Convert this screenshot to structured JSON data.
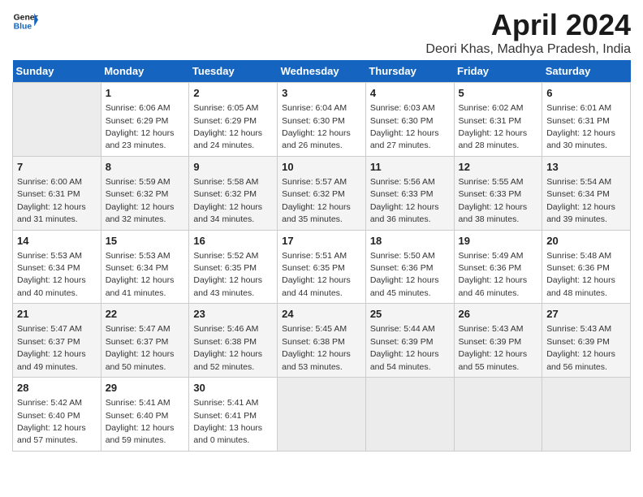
{
  "header": {
    "logo_line1": "General",
    "logo_line2": "Blue",
    "title": "April 2024",
    "subtitle": "Deori Khas, Madhya Pradesh, India"
  },
  "calendar": {
    "days_of_week": [
      "Sunday",
      "Monday",
      "Tuesday",
      "Wednesday",
      "Thursday",
      "Friday",
      "Saturday"
    ],
    "weeks": [
      [
        {
          "day": "",
          "detail": ""
        },
        {
          "day": "1",
          "detail": "Sunrise: 6:06 AM\nSunset: 6:29 PM\nDaylight: 12 hours\nand 23 minutes."
        },
        {
          "day": "2",
          "detail": "Sunrise: 6:05 AM\nSunset: 6:29 PM\nDaylight: 12 hours\nand 24 minutes."
        },
        {
          "day": "3",
          "detail": "Sunrise: 6:04 AM\nSunset: 6:30 PM\nDaylight: 12 hours\nand 26 minutes."
        },
        {
          "day": "4",
          "detail": "Sunrise: 6:03 AM\nSunset: 6:30 PM\nDaylight: 12 hours\nand 27 minutes."
        },
        {
          "day": "5",
          "detail": "Sunrise: 6:02 AM\nSunset: 6:31 PM\nDaylight: 12 hours\nand 28 minutes."
        },
        {
          "day": "6",
          "detail": "Sunrise: 6:01 AM\nSunset: 6:31 PM\nDaylight: 12 hours\nand 30 minutes."
        }
      ],
      [
        {
          "day": "7",
          "detail": "Sunrise: 6:00 AM\nSunset: 6:31 PM\nDaylight: 12 hours\nand 31 minutes."
        },
        {
          "day": "8",
          "detail": "Sunrise: 5:59 AM\nSunset: 6:32 PM\nDaylight: 12 hours\nand 32 minutes."
        },
        {
          "day": "9",
          "detail": "Sunrise: 5:58 AM\nSunset: 6:32 PM\nDaylight: 12 hours\nand 34 minutes."
        },
        {
          "day": "10",
          "detail": "Sunrise: 5:57 AM\nSunset: 6:32 PM\nDaylight: 12 hours\nand 35 minutes."
        },
        {
          "day": "11",
          "detail": "Sunrise: 5:56 AM\nSunset: 6:33 PM\nDaylight: 12 hours\nand 36 minutes."
        },
        {
          "day": "12",
          "detail": "Sunrise: 5:55 AM\nSunset: 6:33 PM\nDaylight: 12 hours\nand 38 minutes."
        },
        {
          "day": "13",
          "detail": "Sunrise: 5:54 AM\nSunset: 6:34 PM\nDaylight: 12 hours\nand 39 minutes."
        }
      ],
      [
        {
          "day": "14",
          "detail": "Sunrise: 5:53 AM\nSunset: 6:34 PM\nDaylight: 12 hours\nand 40 minutes."
        },
        {
          "day": "15",
          "detail": "Sunrise: 5:53 AM\nSunset: 6:34 PM\nDaylight: 12 hours\nand 41 minutes."
        },
        {
          "day": "16",
          "detail": "Sunrise: 5:52 AM\nSunset: 6:35 PM\nDaylight: 12 hours\nand 43 minutes."
        },
        {
          "day": "17",
          "detail": "Sunrise: 5:51 AM\nSunset: 6:35 PM\nDaylight: 12 hours\nand 44 minutes."
        },
        {
          "day": "18",
          "detail": "Sunrise: 5:50 AM\nSunset: 6:36 PM\nDaylight: 12 hours\nand 45 minutes."
        },
        {
          "day": "19",
          "detail": "Sunrise: 5:49 AM\nSunset: 6:36 PM\nDaylight: 12 hours\nand 46 minutes."
        },
        {
          "day": "20",
          "detail": "Sunrise: 5:48 AM\nSunset: 6:36 PM\nDaylight: 12 hours\nand 48 minutes."
        }
      ],
      [
        {
          "day": "21",
          "detail": "Sunrise: 5:47 AM\nSunset: 6:37 PM\nDaylight: 12 hours\nand 49 minutes."
        },
        {
          "day": "22",
          "detail": "Sunrise: 5:47 AM\nSunset: 6:37 PM\nDaylight: 12 hours\nand 50 minutes."
        },
        {
          "day": "23",
          "detail": "Sunrise: 5:46 AM\nSunset: 6:38 PM\nDaylight: 12 hours\nand 52 minutes."
        },
        {
          "day": "24",
          "detail": "Sunrise: 5:45 AM\nSunset: 6:38 PM\nDaylight: 12 hours\nand 53 minutes."
        },
        {
          "day": "25",
          "detail": "Sunrise: 5:44 AM\nSunset: 6:39 PM\nDaylight: 12 hours\nand 54 minutes."
        },
        {
          "day": "26",
          "detail": "Sunrise: 5:43 AM\nSunset: 6:39 PM\nDaylight: 12 hours\nand 55 minutes."
        },
        {
          "day": "27",
          "detail": "Sunrise: 5:43 AM\nSunset: 6:39 PM\nDaylight: 12 hours\nand 56 minutes."
        }
      ],
      [
        {
          "day": "28",
          "detail": "Sunrise: 5:42 AM\nSunset: 6:40 PM\nDaylight: 12 hours\nand 57 minutes."
        },
        {
          "day": "29",
          "detail": "Sunrise: 5:41 AM\nSunset: 6:40 PM\nDaylight: 12 hours\nand 59 minutes."
        },
        {
          "day": "30",
          "detail": "Sunrise: 5:41 AM\nSunset: 6:41 PM\nDaylight: 13 hours\nand 0 minutes."
        },
        {
          "day": "",
          "detail": ""
        },
        {
          "day": "",
          "detail": ""
        },
        {
          "day": "",
          "detail": ""
        },
        {
          "day": "",
          "detail": ""
        }
      ]
    ]
  }
}
